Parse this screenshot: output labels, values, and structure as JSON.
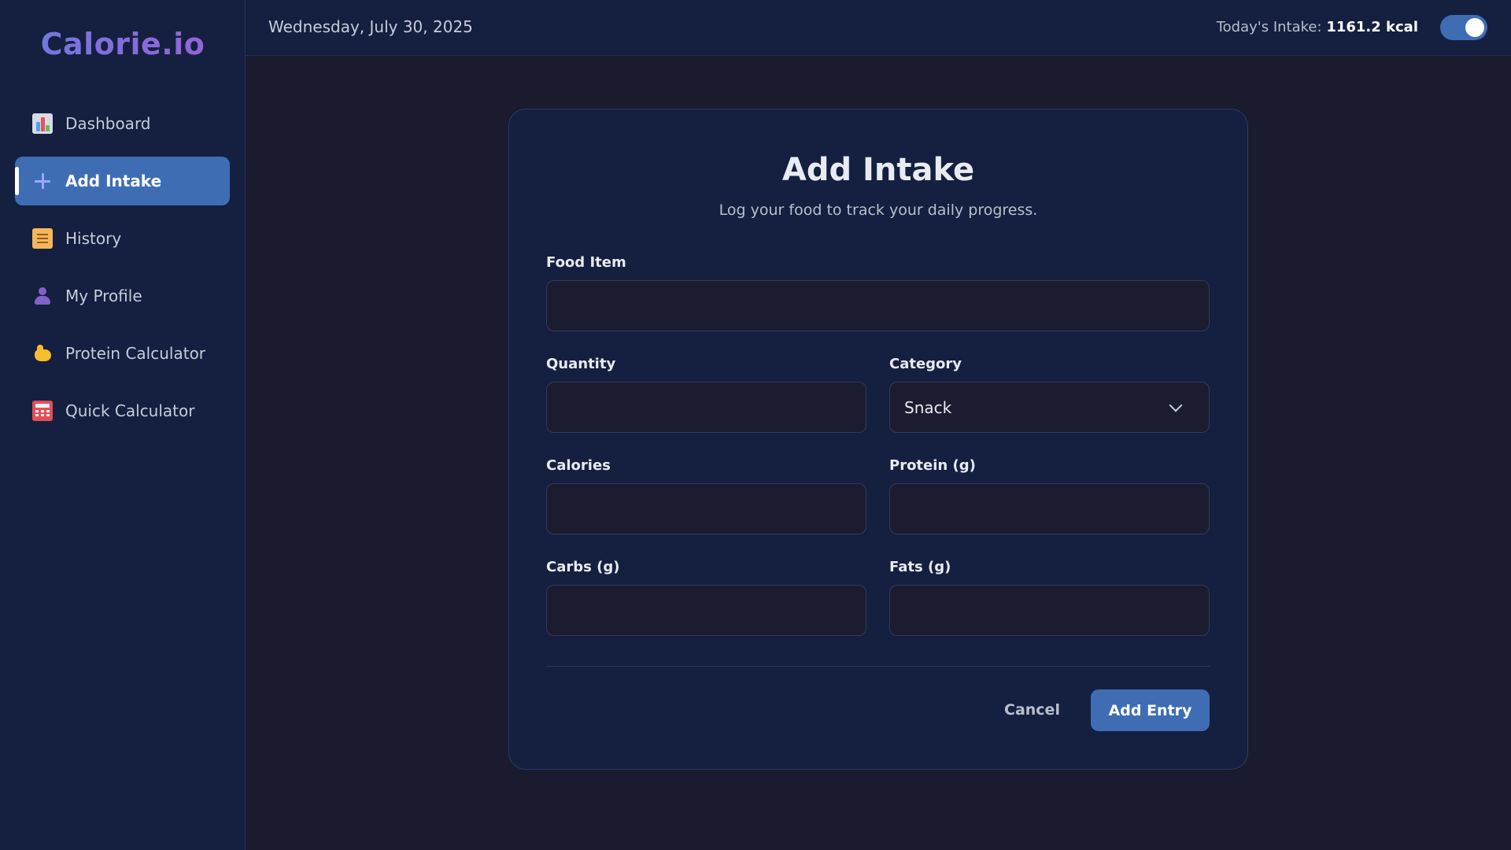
{
  "app": {
    "logo": "Calorie.io"
  },
  "sidebar": {
    "items": [
      {
        "label": "Dashboard",
        "icon": "bar-chart-icon"
      },
      {
        "label": "Add Intake",
        "icon": "plus-icon",
        "active": true
      },
      {
        "label": "History",
        "icon": "scroll-icon"
      },
      {
        "label": "My Profile",
        "icon": "user-icon"
      },
      {
        "label": "Protein Calculator",
        "icon": "flexed-biceps-icon"
      },
      {
        "label": "Quick Calculator",
        "icon": "abacus-icon"
      }
    ]
  },
  "header": {
    "date": "Wednesday, July 30, 2025",
    "intake_label": "Today's Intake:",
    "intake_value": "1161.2 kcal",
    "theme_toggle_on": true
  },
  "form": {
    "title": "Add Intake",
    "subtitle": "Log your food to track your daily progress.",
    "food_item": {
      "label": "Food Item",
      "value": ""
    },
    "quantity": {
      "label": "Quantity",
      "value": ""
    },
    "category": {
      "label": "Category",
      "value": "Snack"
    },
    "calories": {
      "label": "Calories",
      "value": ""
    },
    "protein": {
      "label": "Protein (g)",
      "value": ""
    },
    "carbs": {
      "label": "Carbs (g)",
      "value": ""
    },
    "fats": {
      "label": "Fats (g)",
      "value": ""
    },
    "cancel_label": "Cancel",
    "submit_label": "Add Entry"
  },
  "colors": {
    "accent": "#3e6db3",
    "background": "#1a1b2e",
    "panel": "#152040",
    "logo_gradient_start": "#6b7ce0",
    "logo_gradient_end": "#9b5fd6"
  }
}
